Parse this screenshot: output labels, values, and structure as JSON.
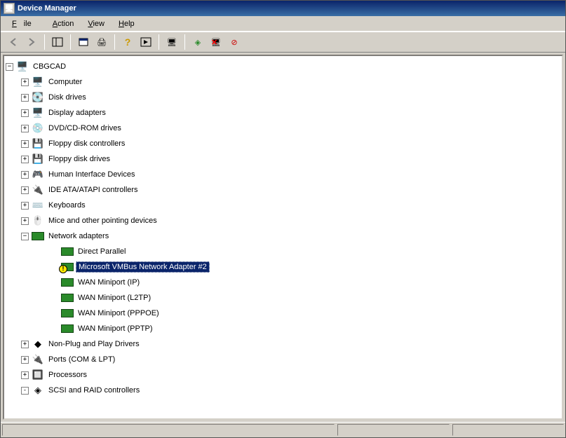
{
  "title": "Device Manager",
  "menu": {
    "file": "File",
    "action": "Action",
    "view": "View",
    "help": "Help"
  },
  "toolbar": {
    "back": "←",
    "forward": "→",
    "props": "properties",
    "print": "print",
    "refresh": "refresh",
    "show": "show-hidden",
    "scan": "scan",
    "uninstall": "uninstall",
    "update": "update",
    "disable": "disable"
  },
  "tree": {
    "root": {
      "label": "CBGCAD",
      "expanded": true
    },
    "categories": [
      {
        "id": "computer",
        "label": "Computer",
        "icon": "🖥️",
        "expanded": false
      },
      {
        "id": "disk",
        "label": "Disk drives",
        "icon": "💽",
        "expanded": false
      },
      {
        "id": "display",
        "label": "Display adapters",
        "icon": "🖥️",
        "expanded": false
      },
      {
        "id": "dvd",
        "label": "DVD/CD-ROM drives",
        "icon": "💿",
        "expanded": false
      },
      {
        "id": "floppyctrl",
        "label": "Floppy disk controllers",
        "icon": "💾",
        "expanded": false
      },
      {
        "id": "floppy",
        "label": "Floppy disk drives",
        "icon": "💾",
        "expanded": false
      },
      {
        "id": "hid",
        "label": "Human Interface Devices",
        "icon": "🎮",
        "expanded": false
      },
      {
        "id": "ide",
        "label": "IDE ATA/ATAPI controllers",
        "icon": "🔌",
        "expanded": false
      },
      {
        "id": "keyboard",
        "label": "Keyboards",
        "icon": "⌨️",
        "expanded": false
      },
      {
        "id": "mouse",
        "label": "Mice and other pointing devices",
        "icon": "🖱️",
        "expanded": false
      },
      {
        "id": "network",
        "label": "Network adapters",
        "icon": "net",
        "expanded": true,
        "children": [
          {
            "label": "Direct Parallel",
            "warn": false,
            "selected": false
          },
          {
            "label": "Microsoft VMBus Network Adapter #2",
            "warn": true,
            "selected": true
          },
          {
            "label": "WAN Miniport (IP)",
            "warn": false,
            "selected": false
          },
          {
            "label": "WAN Miniport (L2TP)",
            "warn": false,
            "selected": false
          },
          {
            "label": "WAN Miniport (PPPOE)",
            "warn": false,
            "selected": false
          },
          {
            "label": "WAN Miniport (PPTP)",
            "warn": false,
            "selected": false
          }
        ]
      },
      {
        "id": "nonpnp",
        "label": "Non-Plug and Play Drivers",
        "icon": "◆",
        "expanded": false
      },
      {
        "id": "ports",
        "label": "Ports (COM & LPT)",
        "icon": "🔌",
        "expanded": false
      },
      {
        "id": "cpu",
        "label": "Processors",
        "icon": "🔲",
        "expanded": false
      },
      {
        "id": "scsi",
        "label": "SCSI and RAID controllers",
        "icon": "◈",
        "expanded": false,
        "lastExpander": "-"
      }
    ]
  }
}
